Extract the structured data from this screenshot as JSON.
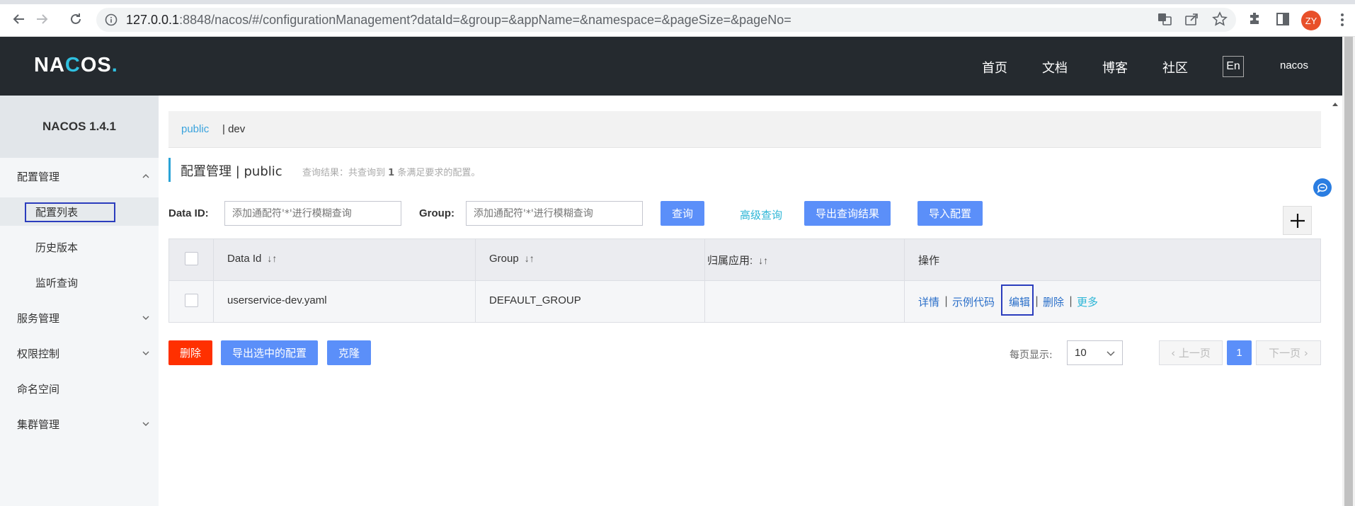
{
  "browser": {
    "url_host": "127.0.0.1",
    "url_rest": ":8848/nacos/#/configurationManagement?dataId=&group=&appName=&namespace=&pageSize=&pageNo=",
    "avatar_initials": "ZY"
  },
  "header": {
    "logo_prefix": "NA",
    "logo_c": "C",
    "logo_suffix": "OS",
    "logo_dot": ".",
    "nav": [
      "首页",
      "文档",
      "博客",
      "社区"
    ],
    "lang": "En",
    "user": "nacos"
  },
  "sidebar": {
    "version": "NACOS 1.4.1",
    "items": [
      {
        "label": "配置管理"
      },
      {
        "label": "配置列表"
      },
      {
        "label": "历史版本"
      },
      {
        "label": "监听查询"
      },
      {
        "label": "服务管理"
      },
      {
        "label": "权限控制"
      },
      {
        "label": "命名空间"
      },
      {
        "label": "集群管理"
      }
    ]
  },
  "namespaces": {
    "active": "public",
    "other": "| dev"
  },
  "page": {
    "title": "配置管理  |  public",
    "result_prefix": "查询结果：共查询到 ",
    "result_count": "1",
    "result_suffix": " 条满足要求的配置。"
  },
  "filters": {
    "dataid_label": "Data ID:",
    "dataid_placeholder": "添加通配符'*'进行模糊查询",
    "group_label": "Group:",
    "group_placeholder": "添加通配符'*'进行模糊查询",
    "query": "查询",
    "advanced": "高级查询",
    "export_results": "导出查询结果",
    "import": "导入配置"
  },
  "table": {
    "columns": [
      "Data Id",
      "Group",
      "归属应用:",
      "操作"
    ],
    "rows": [
      {
        "data_id": "userservice-dev.yaml",
        "group": "DEFAULT_GROUP",
        "app": ""
      }
    ],
    "ops": [
      "详情",
      "示例代码",
      "编辑",
      "删除",
      "更多"
    ]
  },
  "footer": {
    "delete": "删除",
    "export_selected": "导出选中的配置",
    "clone": "克隆",
    "page_size_label": "每页显示:",
    "page_size": "10",
    "prev": "上一页",
    "current": "1",
    "next": "下一页"
  },
  "colors": {
    "accent": "#5b8ff9",
    "danger": "#ff3000",
    "header_bg": "#252a2f",
    "link": "#2a6fc9"
  }
}
